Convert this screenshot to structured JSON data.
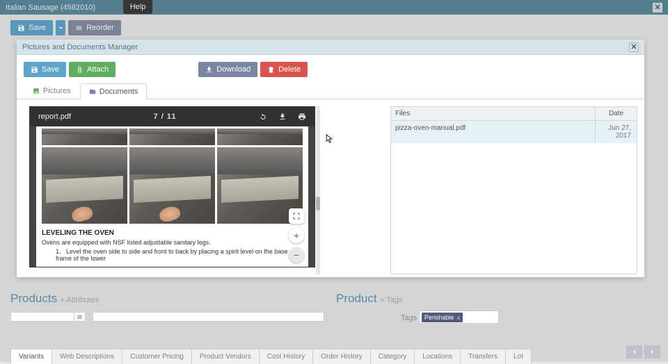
{
  "titleBar": {
    "title": "Italian Sausage (4582010)"
  },
  "help": "Help",
  "mainToolbar": {
    "save": "Save",
    "reorder": "Reorder"
  },
  "modal": {
    "title": "Pictures and Documents Manager",
    "toolbar": {
      "save": "Save",
      "attach": "Attach",
      "download": "Download",
      "delete": "Delete"
    },
    "tabs": {
      "pictures": "Pictures",
      "documents": "Documents"
    }
  },
  "pdf": {
    "filename": "report.pdf",
    "page": "7",
    "sep": "/",
    "total": "11",
    "heading": "LEVELING THE OVEN",
    "body": "Ovens are equipped with NSF listed adjustable sanitary legs.",
    "li_num": "1.",
    "li": "Level the oven side to side and front to back by placing a spirit level on the base frame of the lower"
  },
  "files": {
    "header": {
      "files": "Files",
      "date": "Date"
    },
    "rows": [
      {
        "name": "pizza-oven-manual.pdf",
        "date": "Jun 27, 2017"
      }
    ]
  },
  "products": {
    "title": "Products",
    "sub": "» Attributes"
  },
  "product": {
    "title": "Product",
    "sub": "» Tags"
  },
  "tagsLabel": "Tags",
  "tag": {
    "label": "Perishable"
  },
  "bottomTabs": [
    "Variants",
    "Web Descriptions",
    "Customer Pricing",
    "Product Vendors",
    "Cost History",
    "Order History",
    "Category",
    "Locations",
    "Transfers",
    "Lot"
  ],
  "icons": {
    "plus": "+",
    "minus": "−"
  }
}
